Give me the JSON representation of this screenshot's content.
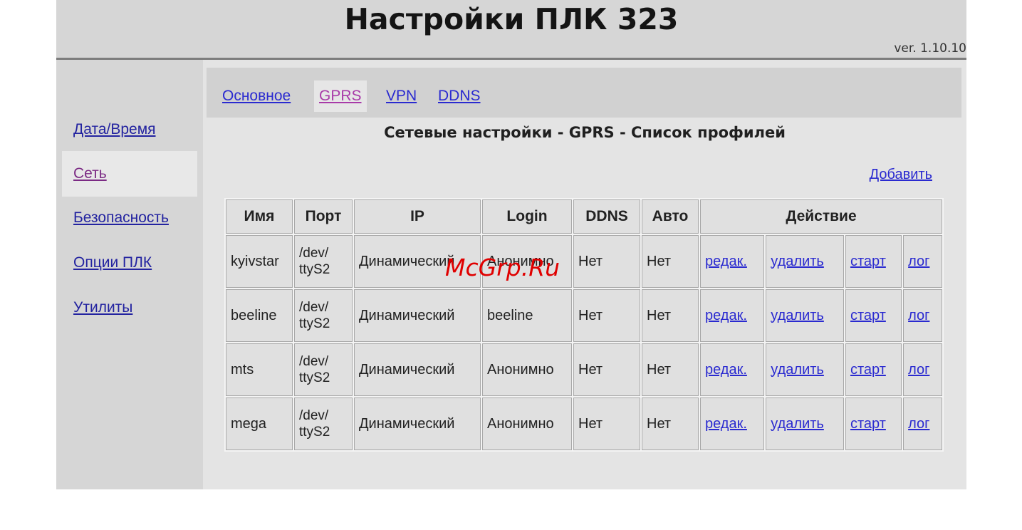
{
  "header": {
    "title": "Настройки ПЛК 323",
    "version": "ver. 1.10.10"
  },
  "sidebar": {
    "items": [
      {
        "label": "Дата/Время"
      },
      {
        "label": "Сеть"
      },
      {
        "label": "Безопасность"
      },
      {
        "label": "Опции ПЛК"
      },
      {
        "label": "Утилиты"
      }
    ],
    "active": "Сеть"
  },
  "tabs": [
    {
      "label": "Основное"
    },
    {
      "label": "GPRS"
    },
    {
      "label": "VPN"
    },
    {
      "label": "DDNS"
    }
  ],
  "active_tab": "GPRS",
  "section_title": "Сетевые настройки - GPRS - Список профилей",
  "add_label": "Добавить",
  "table": {
    "headers": [
      "Имя",
      "Порт",
      "IP",
      "Login",
      "DDNS",
      "Авто",
      "Действие"
    ],
    "rows": [
      {
        "name": "kyivstar",
        "port_line1": "/dev/",
        "port_line2": "ttyS2",
        "ip": "Динамический",
        "login": "Анонимно",
        "ddns": "Нет",
        "auto": "Нет"
      },
      {
        "name": "beeline",
        "port_line1": "/dev/",
        "port_line2": "ttyS2",
        "ip": "Динамический",
        "login": "beeline",
        "ddns": "Нет",
        "auto": "Нет"
      },
      {
        "name": "mts",
        "port_line1": "/dev/",
        "port_line2": "ttyS2",
        "ip": "Динамический",
        "login": "Анонимно",
        "ddns": "Нет",
        "auto": "Нет"
      },
      {
        "name": "mega",
        "port_line1": "/dev/",
        "port_line2": "ttyS2",
        "ip": "Динамический",
        "login": "Анонимно",
        "ddns": "Нет",
        "auto": "Нет"
      }
    ],
    "actions": {
      "edit": "редак.",
      "delete": "удалить",
      "start": "старт",
      "log": "лог"
    }
  },
  "watermark": "McGrp.Ru",
  "colors": {
    "link": "#2a2ad0",
    "visited_link": "#a83aa8",
    "watermark": "#e00000"
  }
}
